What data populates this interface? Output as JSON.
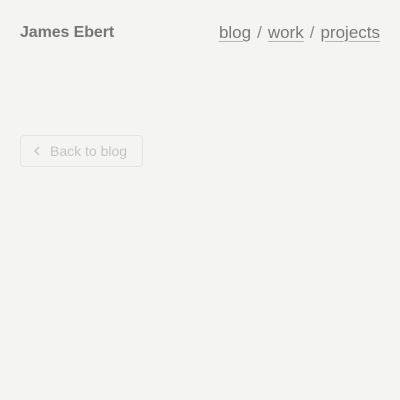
{
  "header": {
    "site_title": "James Ebert",
    "nav": {
      "blog": "blog",
      "sep1": "/",
      "work": "work",
      "sep2": "/",
      "projects": "projects"
    }
  },
  "main": {
    "back_button_label": "Back to blog",
    "back_icon": "chevron-left-icon"
  }
}
